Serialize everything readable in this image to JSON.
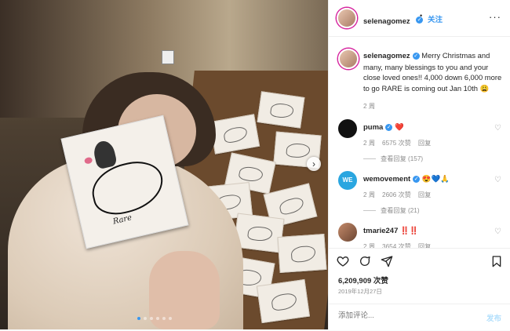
{
  "post": {
    "username": "selenagomez",
    "follow_label": "关注",
    "more_label": "···",
    "caption_text": "Merry Christmas and many, many blessings to you and your close loved ones!! 4,000 down 6,000 more to go RARE is coming out Jan 10th 😩",
    "caption_age": "2 周",
    "likes": "6,209,909 次赞",
    "date": "2019年12月27日",
    "add_comment_placeholder": "添加评论...",
    "post_label": "发布"
  },
  "photo": {
    "card_text": "Rare",
    "next_icon": "chevron-right-icon",
    "slide_count": 6,
    "active_slide": 0
  },
  "comments": [
    {
      "user": "puma",
      "text": "❤️",
      "age": "2 周",
      "likes": "6575 次赞",
      "reply": "回复",
      "view_replies": "查看回复 (157)"
    },
    {
      "user": "wemovement",
      "text": "😍💙🙏",
      "age": "2 周",
      "likes": "2606 次赞",
      "reply": "回复",
      "view_replies": "查看回复 (21)"
    },
    {
      "user": "tmarie247",
      "text": "‼️‼️",
      "age": "2 周",
      "likes": "3654 次赞",
      "reply": "回复",
      "view_replies": ""
    }
  ],
  "icons": [
    "heart-icon",
    "comment-icon",
    "share-icon",
    "bookmark-icon",
    "verified-icon"
  ],
  "colors": {
    "link_blue": "#3897f0",
    "text": "#262626",
    "muted": "#8e8e8e",
    "heart_red": "#ed4956"
  }
}
